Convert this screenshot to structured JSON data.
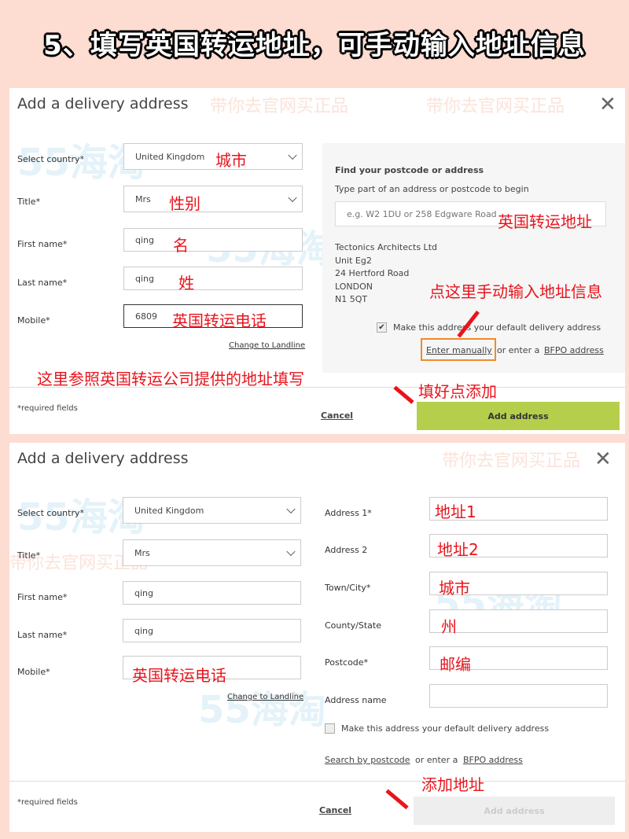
{
  "title": "5、填写英国转运地址，可手动输入地址信息",
  "watermark": {
    "logo": "55海淘",
    "slogan": "带你去官网买正品"
  },
  "form1": {
    "heading": "Add a delivery address",
    "labels": {
      "country": "Select country*",
      "title": "Title*",
      "first": "First name*",
      "last": "Last name*",
      "mobile": "Mobile*"
    },
    "values": {
      "country": "United Kingdom",
      "title": "Mrs",
      "first": "qing",
      "last": "qing",
      "mobile": "6809"
    },
    "change_landline": "Change to Landline",
    "finder": {
      "heading": "Find your postcode or address",
      "hint": "Type part of an address or postcode to begin",
      "placeholder": "e.g. W2 1DU or 258 Edgware Road",
      "address": [
        "Tectonics Architects Ltd",
        "Unit Eg2",
        "24 Hertford Road",
        "LONDON",
        "N1 5QT"
      ]
    },
    "default_checkbox": "Make this address your default delivery address",
    "default_checked": true,
    "enter_manually": "Enter manually",
    "or_enter": "or enter a",
    "bfpo": "BFPO address",
    "required": "*required fields",
    "cancel": "Cancel",
    "add": "Add address",
    "annotations": {
      "country": "城市",
      "title": "性别",
      "first": "名",
      "last": "姓",
      "mobile": "英国转运电话",
      "address": "英国转运地址",
      "manual": "点这里手动输入地址信息",
      "note": "这里参照英国转运公司提供的地址填写",
      "done": "填好点添加"
    }
  },
  "form2": {
    "heading": "Add a delivery address",
    "labels": {
      "country": "Select country*",
      "title": "Title*",
      "first": "First name*",
      "last": "Last name*",
      "mobile": "Mobile*",
      "addr1": "Address 1*",
      "addr2": "Address 2",
      "town": "Town/City*",
      "county": "County/State",
      "postcode": "Postcode*",
      "name": "Address name"
    },
    "values": {
      "country": "United Kingdom",
      "title": "Mrs",
      "first": "qing",
      "last": "qing"
    },
    "change_landline": "Change to Landline",
    "default_checkbox": "Make this address your default delivery address",
    "default_checked": false,
    "search_postcode": "Search by postcode",
    "or_enter": "or enter a",
    "bfpo": "BFPO address",
    "required": "*required fields",
    "cancel": "Cancel",
    "add": "Add address",
    "annotations": {
      "mobile": "英国转运电话",
      "addr1": "地址1",
      "addr2": "地址2",
      "town": "城市",
      "county": "州",
      "postcode": "邮编",
      "done": "添加地址"
    }
  },
  "colors": {
    "accent": "#b5cf4c",
    "annotation": "#e8141c",
    "highlight": "#f08a2c",
    "background": "#fddcd1"
  }
}
